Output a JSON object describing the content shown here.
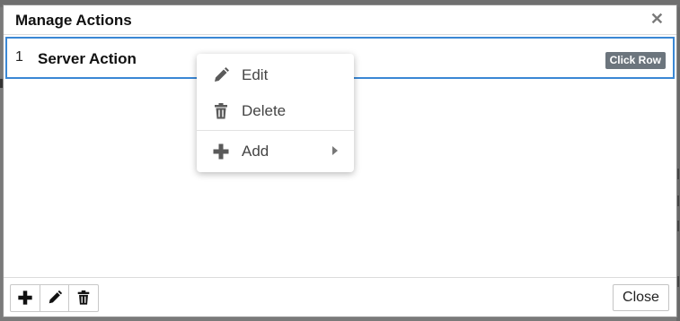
{
  "dialog": {
    "title": "Manage Actions",
    "close_symbol": "✕"
  },
  "rows": [
    {
      "index": "1",
      "name": "Server Action",
      "badge": "Click Row"
    }
  ],
  "context_menu": {
    "items": [
      {
        "label": "Edit",
        "icon": "pencil-icon"
      },
      {
        "label": "Delete",
        "icon": "trash-icon"
      },
      {
        "label": "Add",
        "icon": "plus-icon",
        "has_submenu": true
      }
    ]
  },
  "footer": {
    "tools": [
      "plus-icon",
      "pencil-icon",
      "trash-icon"
    ],
    "close_label": "Close"
  },
  "colors": {
    "selection_border": "#3a87d4",
    "badge_bg": "#6c757d"
  }
}
